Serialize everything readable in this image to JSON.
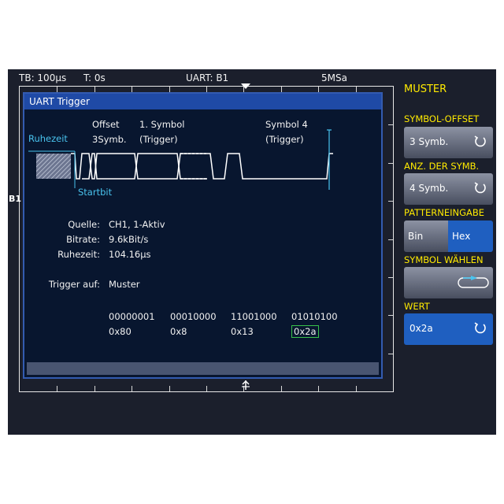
{
  "status_bar": {
    "timebase": "TB: 100µs",
    "trigger_time": "T: 0s",
    "bus": "UART: B1",
    "sample_rate": "5MSa"
  },
  "screen_markers": {
    "bus_left": "B1"
  },
  "dialog": {
    "title": "UART Trigger",
    "diagram": {
      "idle_label": "Ruhezeit",
      "offset_label": "Offset",
      "offset_value": "3Symb.",
      "first_symbol_label": "1. Symbol",
      "first_symbol_sub": "(Trigger)",
      "symbol4_label": "Symbol 4",
      "symbol4_sub": "(Trigger)",
      "start_bit_label": "Startbit"
    },
    "settings": [
      {
        "label": "Quelle:",
        "value": "CH1, 1-Aktiv"
      },
      {
        "label": "Bitrate:",
        "value": "9.6kBit/s"
      },
      {
        "label": "Ruhezeit:",
        "value": "104.16µs"
      }
    ],
    "trigger_on": {
      "label": "Trigger auf:",
      "value": "Muster"
    },
    "symbols_binary": [
      "00000001",
      "00010000",
      "11001000",
      "01010100"
    ],
    "symbols_hex": [
      "0x80",
      "0x8",
      "0x13",
      "0x2a"
    ],
    "selected_symbol_index": 3
  },
  "menu": {
    "title": "MUSTER",
    "symbol_offset": {
      "label": "SYMBOL-OFFSET",
      "value": "3 Symb."
    },
    "num_symbols": {
      "label": "ANZ. DER SYMB.",
      "value": "4 Symb."
    },
    "pattern_input": {
      "label": "PATTERNEINGABE",
      "options": [
        "Bin",
        "Hex"
      ],
      "selected": "Hex"
    },
    "symbol_select": {
      "label": "SYMBOL WÄHLEN"
    },
    "value": {
      "label": "WERT",
      "value": "0x2a"
    }
  },
  "colors": {
    "accent_cyan": "#49c3ee",
    "menu_heading": "#ffea00",
    "dialog_title_bg": "#1f4aa6",
    "hex_selected_bg": "#1f5fc0",
    "selected_symbol": "#38c24a"
  }
}
